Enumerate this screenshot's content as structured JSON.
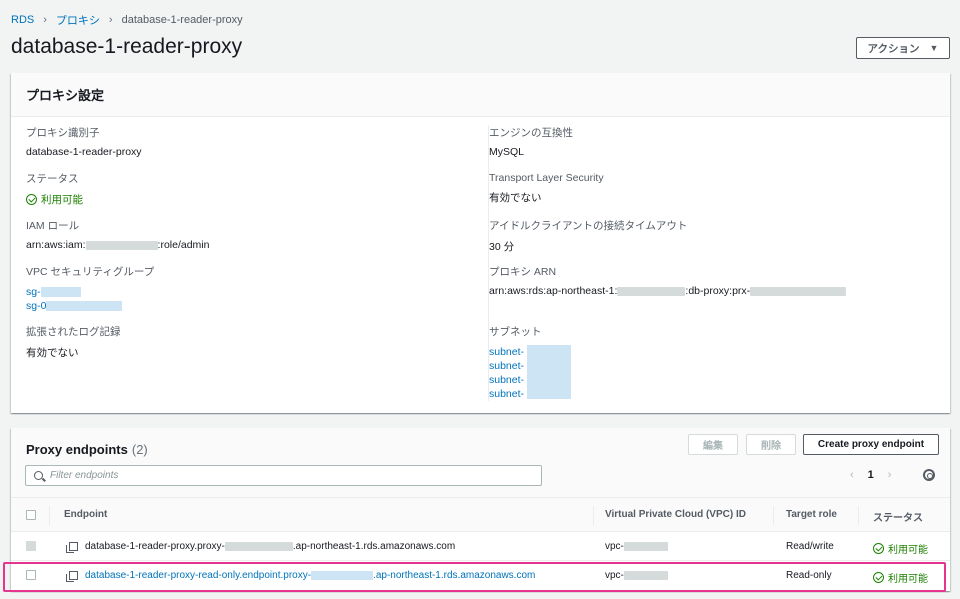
{
  "breadcrumb": {
    "root": "RDS",
    "parent": "プロキシ",
    "current": "database-1-reader-proxy"
  },
  "page_title": "database-1-reader-proxy",
  "actions_label": "アクション",
  "settings": {
    "title": "プロキシ設定",
    "proxy_id_label": "プロキシ識別子",
    "proxy_id_value": "database-1-reader-proxy",
    "status_label": "ステータス",
    "status_value": "利用可能",
    "iam_role_label": "IAM ロール",
    "iam_role_prefix": "arn:aws:iam:",
    "iam_role_suffix": ":role/admin",
    "vpc_sg_label": "VPC セキュリティグループ",
    "vpc_sg_1": "sg-",
    "vpc_sg_2": "sg-0",
    "log_label": "拡張されたログ記録",
    "log_value": "有効でない",
    "engine_label": "エンジンの互換性",
    "engine_value": "MySQL",
    "tls_label": "Transport Layer Security",
    "tls_value": "有効でない",
    "idle_label": "アイドルクライアントの接続タイムアウト",
    "idle_value": "30 分",
    "arn_label": "プロキシ ARN",
    "arn_prefix": "arn:aws:rds:ap-northeast-1:",
    "arn_middle": ":db-proxy:prx-",
    "subnet_label": "サブネット",
    "subnets": [
      "subnet-",
      "subnet-",
      "subnet-",
      "subnet-"
    ]
  },
  "endpoints": {
    "title": "Proxy endpoints",
    "count": "(2)",
    "edit_label": "編集",
    "delete_label": "削除",
    "create_label": "Create proxy endpoint",
    "filter_placeholder": "Filter endpoints",
    "page": "1",
    "columns": {
      "endpoint": "Endpoint",
      "vpc": "Virtual Private Cloud (VPC) ID",
      "role": "Target role",
      "status": "ステータス"
    },
    "rows": [
      {
        "endpoint_prefix": "database-1-reader-proxy.proxy-",
        "endpoint_suffix": ".ap-northeast-1.rds.amazonaws.com",
        "vpc": "vpc-",
        "role": "Read/write",
        "status": "利用可能"
      },
      {
        "endpoint_prefix": "database-1-reader-proxy-read-only.endpoint.proxy-",
        "endpoint_suffix": ".ap-northeast-1.rds.amazonaws.com",
        "vpc": "vpc-",
        "role": "Read-only",
        "status": "利用可能"
      }
    ]
  },
  "colors": {
    "link": "#0073bb",
    "success": "#1d8102",
    "highlight": "#e6358e"
  }
}
